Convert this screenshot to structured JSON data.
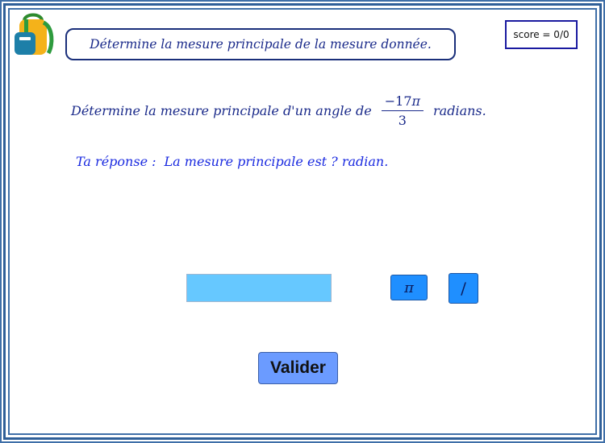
{
  "instruction": "Détermine la mesure principale de la mesure donnée.",
  "score": "score = 0/0",
  "question": {
    "prefix": "Détermine la mesure principale d'un angle de",
    "numerator": "−17",
    "pi_symbol": "π",
    "denominator": "3",
    "suffix": "radians."
  },
  "answer": {
    "label": "Ta réponse :",
    "text": "La mesure principale est ? radian."
  },
  "input": {
    "value": ""
  },
  "buttons": {
    "pi": "π",
    "slash": "/",
    "validate": "Valider"
  },
  "icons": {
    "logo": "backpack-icon"
  },
  "colors": {
    "text_blue": "#1a2a8a",
    "answer_blue": "#1a2ae0",
    "input_bg": "#66c8ff",
    "button_bg": "#1f8fff",
    "validate_bg": "#6b9bff"
  }
}
